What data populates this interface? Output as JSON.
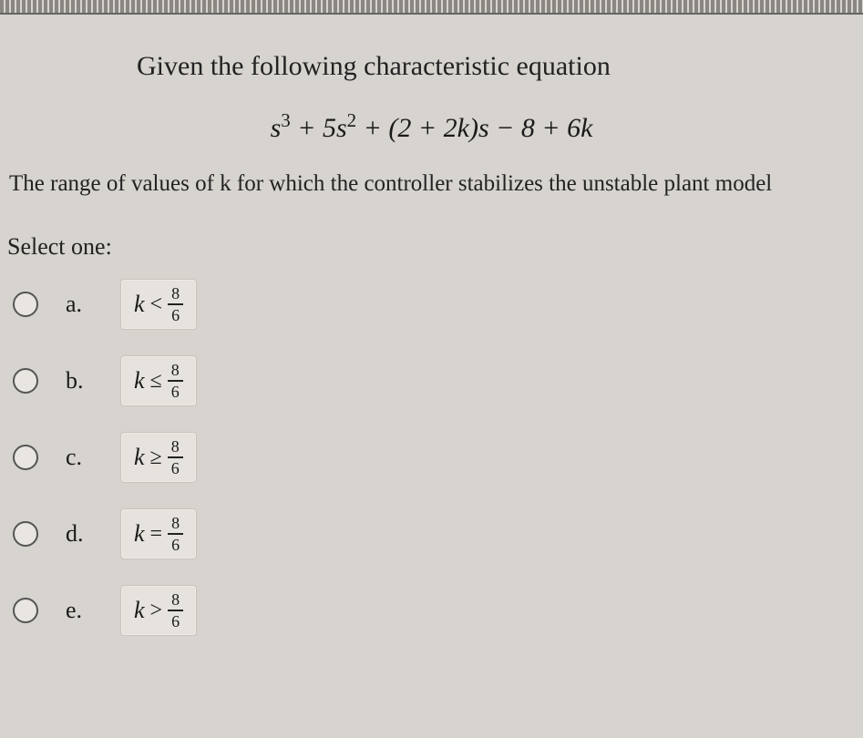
{
  "question": {
    "intro": "Given the following characteristic equation",
    "equation_html": "s<sup>3</sup> + 5s<sup>2</sup> + (2 + 2k)s − 8 + 6k",
    "range_text": "The range of values of k for which the controller stabilizes the unstable plant model",
    "select_label": "Select one:"
  },
  "fraction": {
    "num": "8",
    "den": "6",
    "variable": "k"
  },
  "options": [
    {
      "label": "a.",
      "op": "<"
    },
    {
      "label": "b.",
      "op": "≤"
    },
    {
      "label": "c.",
      "op": "≥"
    },
    {
      "label": "d.",
      "op": "="
    },
    {
      "label": "e.",
      "op": ">"
    }
  ]
}
